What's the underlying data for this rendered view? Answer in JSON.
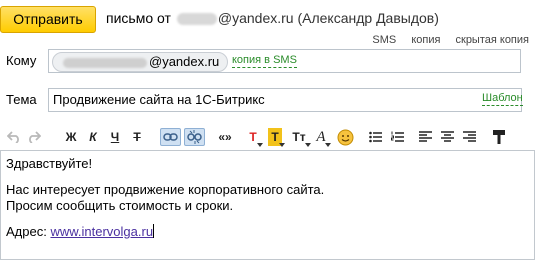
{
  "header": {
    "send_label": "Отправить",
    "from_prefix": "письмо от",
    "from_address": "@yandex.ru (Александр Давыдов)"
  },
  "top_links": [
    "SMS",
    "копия",
    "скрытая копия"
  ],
  "to": {
    "label": "Кому",
    "recipient": "@yandex.ru",
    "sms_copy": "копия в SMS"
  },
  "subject": {
    "label": "Тема",
    "value": "Продвижение сайта на 1С-Битрикс",
    "template_link": "Шаблон"
  },
  "toolbar": {
    "undo_icon": "undo-icon",
    "redo_icon": "redo-icon",
    "bold": "Ж",
    "italic": "К",
    "underline": "Ч",
    "strike": "Т",
    "quote": "«»",
    "font_color": "T",
    "bg_color": "T",
    "font_size": "Tт",
    "font_family": "A",
    "emoji_icon": "smiley-icon"
  },
  "body": {
    "greeting": "Здравствуйте!",
    "line1": "Нас интересует продвижение корпоративного сайта.",
    "line2": "Просим сообщить стоимость и сроки.",
    "address_label": "Адрес:",
    "address_link": "www.intervolga.ru"
  },
  "colors": {
    "send_button": "#ffcc00",
    "link_green": "#2a8c2a",
    "link_purple": "#4a30a0"
  }
}
